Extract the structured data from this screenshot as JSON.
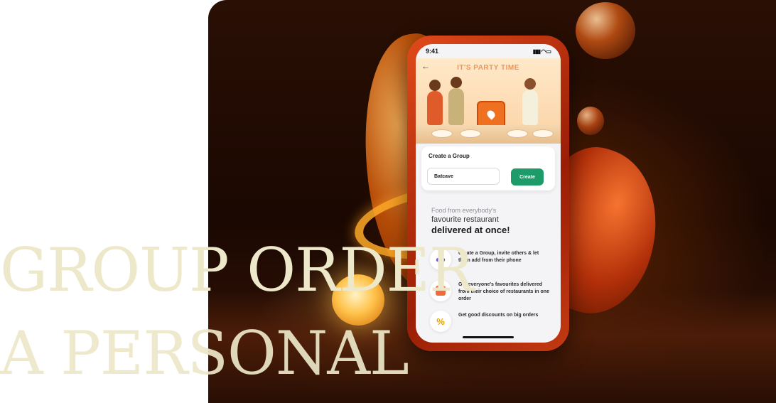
{
  "headline": {
    "line1": "GROUP ORDER",
    "line2": "A PERSONAL"
  },
  "phone": {
    "status_time": "9:41",
    "status_icons": "▮▮▮ ◠ ▭",
    "banner_title": "IT'S PARTY TIME",
    "back_icon": "←",
    "create_group": {
      "title": "Create a Group",
      "input_value": "Batcave",
      "button_label": "Create"
    },
    "tagline": {
      "line1": "Food from everybody's",
      "line2": "favourite restaurant",
      "line3": "delivered at once!"
    },
    "features": [
      {
        "icon": "people-icon",
        "text": "Create a Group, invite others & let them add from their phone"
      },
      {
        "icon": "shopping-bag-icon",
        "text": "Get everyone's favourites delivered from their choice of restaurants in one order"
      },
      {
        "icon": "percent-icon",
        "glyph": "%",
        "text": "Get good discounts on big orders"
      }
    ]
  },
  "colors": {
    "headline": "#ede8c9",
    "create_button": "#1d9c6a",
    "phone_frame": "#c8320e"
  }
}
